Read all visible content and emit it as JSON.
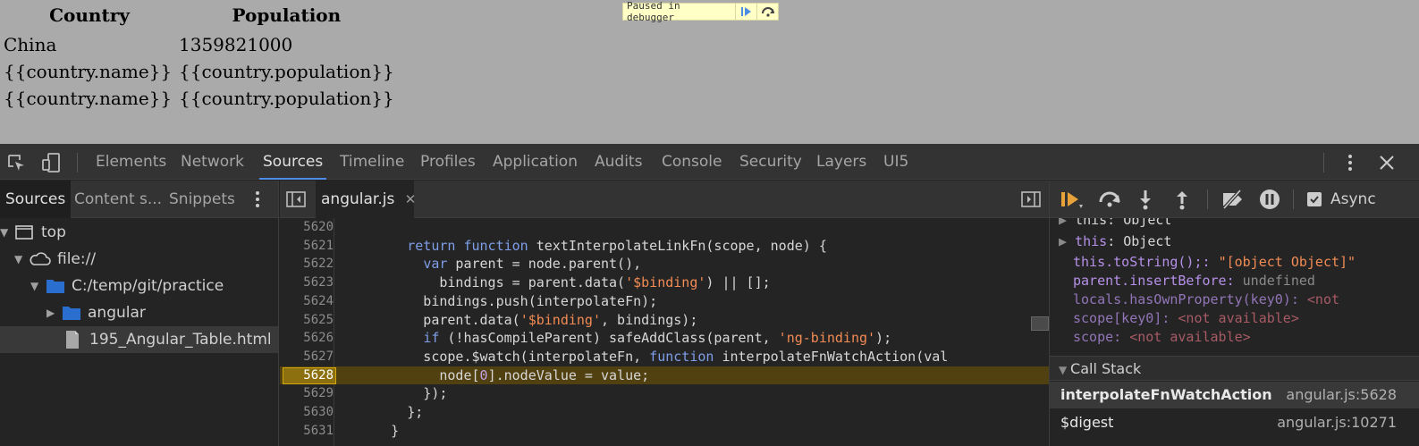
{
  "page": {
    "headers": [
      "Country",
      "Population"
    ],
    "rows": [
      [
        "China",
        "1359821000"
      ],
      [
        "{{country.name}}",
        "{{country.population}}"
      ],
      [
        "{{country.name}}",
        "{{country.population}}"
      ]
    ]
  },
  "paused_banner": {
    "text": "Paused in debugger"
  },
  "devtools": {
    "main_tabs": [
      "Elements",
      "Network",
      "Sources",
      "Timeline",
      "Profiles",
      "Application",
      "Audits",
      "Console",
      "Security",
      "Layers",
      "UI5"
    ],
    "active_tab": "Sources",
    "navigator": {
      "tabs": [
        "Sources",
        "Content s...",
        "Snippets"
      ],
      "tree": [
        {
          "label": "top",
          "icon": "frame-icon",
          "depth": 0,
          "expanded": true
        },
        {
          "label": "file://",
          "icon": "cloud-icon",
          "depth": 1,
          "expanded": true
        },
        {
          "label": "C:/temp/git/practice",
          "icon": "folder-icon",
          "depth": 2,
          "expanded": true
        },
        {
          "label": "angular",
          "icon": "folder-icon",
          "depth": 3,
          "expanded": false
        },
        {
          "label": "195_Angular_Table.html",
          "icon": "file-icon",
          "depth": 3,
          "selected": true
        }
      ]
    },
    "editor": {
      "file_tab": "angular.js",
      "current_line": "5628",
      "lines": [
        {
          "n": "5620",
          "code": ""
        },
        {
          "n": "5621",
          "code": "        return function textInterpolateLinkFn(scope, node) {"
        },
        {
          "n": "5622",
          "code": "          var parent = node.parent(),"
        },
        {
          "n": "5623",
          "code": "            bindings = parent.data('$binding') || [];"
        },
        {
          "n": "5624",
          "code": "          bindings.push(interpolateFn);"
        },
        {
          "n": "5625",
          "code": "          parent.data('$binding', bindings);"
        },
        {
          "n": "5626",
          "code": "          if (!hasCompileParent) safeAddClass(parent, 'ng-binding');"
        },
        {
          "n": "5627",
          "code": "          scope.$watch(interpolateFn, function interpolateFnWatchAction(val"
        },
        {
          "n": "5628",
          "code": "            node[0].nodeValue = value;"
        },
        {
          "n": "5629",
          "code": "          });"
        },
        {
          "n": "5630",
          "code": "        };"
        },
        {
          "n": "5631",
          "code": "      }"
        }
      ]
    },
    "sidebar": {
      "async_label": "Async",
      "async_checked": true,
      "scope_partial": "this: Object",
      "this_row": {
        "key": "this",
        "value": "Object"
      },
      "watch": [
        {
          "key": "this.toString();",
          "sep": ": ",
          "value": "\"[object Object]\""
        },
        {
          "key": "parent.insertBefore",
          "sep": ": ",
          "value": "undefined"
        },
        {
          "key": "locals.hasOwnProperty(key0)",
          "sep": ": ",
          "value": "<not"
        },
        {
          "key": "scope[key0]",
          "sep": ": ",
          "value": "<not available>"
        },
        {
          "key": "scope",
          "sep": ": ",
          "value": "<not available>"
        }
      ],
      "call_stack_title": "Call Stack",
      "call_stack": [
        {
          "name": "interpolateFnWatchAction",
          "location": "angular.js:5628"
        },
        {
          "name": "$digest",
          "location": "angular.js:10271"
        }
      ]
    }
  },
  "colors": {
    "accent": "#4d8ce8",
    "exec_line": "#8c6f0f",
    "page_bg": "#aaaaaa"
  }
}
